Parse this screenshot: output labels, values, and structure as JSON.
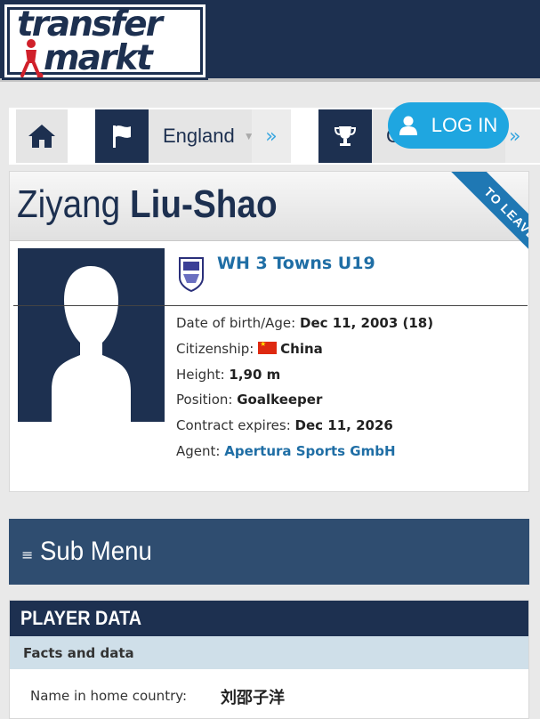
{
  "header": {
    "logo_line1": "transfer",
    "logo_line2": "markt"
  },
  "navbar": {
    "home_icon": "home-icon",
    "flag_icon": "flag-icon",
    "country": "England",
    "trophy_icon": "trophy-icon",
    "competition": "Comp",
    "arrow": "»"
  },
  "login": {
    "label": "LOG IN",
    "icon": "user-icon"
  },
  "profile": {
    "first_name": "Ziyang",
    "last_name": "Liu-Shao",
    "ribbon": "TO LEAVE ...",
    "club": "WH 3 Towns U19",
    "dob_label": "Date of birth/Age:",
    "dob_value": "Dec 11, 2003 (18)",
    "citizenship_label": "Citizenship:",
    "citizenship_value": "China",
    "height_label": "Height:",
    "height_value": "1,90 m",
    "position_label": "Position:",
    "position_value": "Goalkeeper",
    "contract_label": "Contract expires:",
    "contract_value": "Dec 11, 2026",
    "agent_label": "Agent:",
    "agent_value": "Apertura Sports GmbH"
  },
  "submenu": {
    "icon": "≡",
    "label": "Sub Menu"
  },
  "player_data": {
    "title": "PLAYER DATA",
    "section": "Facts and data",
    "rows": [
      {
        "key": "Name in home country:",
        "value": "刘邵子洋"
      }
    ]
  },
  "colors": {
    "navy": "#1d3050",
    "accent_blue": "#1fa6e0",
    "link_blue": "#1f6ea5",
    "submenu": "#2f4d70"
  }
}
